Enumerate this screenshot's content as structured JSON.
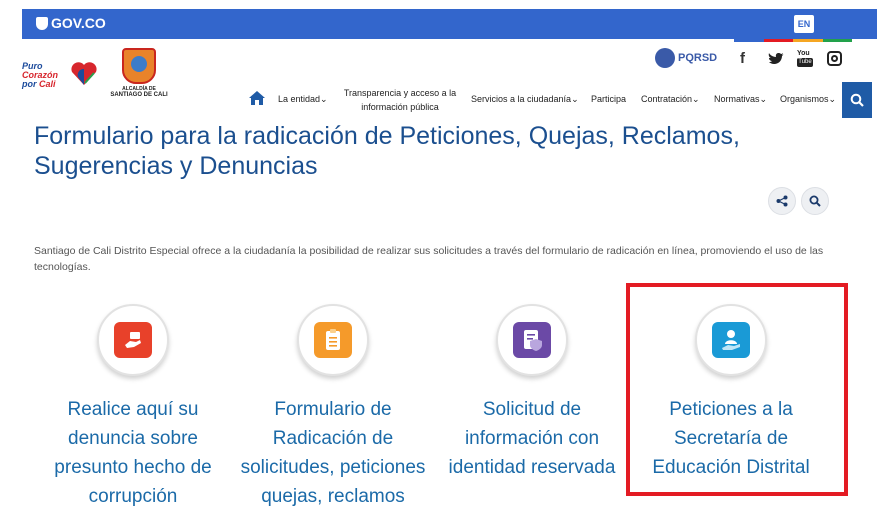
{
  "govbar": {
    "logo_text": "GOV.CO",
    "lang": "EN",
    "strip_colors": [
      "#3366cc",
      "#e31b23",
      "#f5a623",
      "#22a14b"
    ]
  },
  "header": {
    "brand": {
      "line1": "Puro",
      "line2": "Corazón",
      "line3": "por",
      "line4": "Cali"
    },
    "alcaldia": {
      "line1": "ALCALDÍA DE",
      "line2": "SANTIAGO DE CALI"
    },
    "pqrsd": "PQRSD",
    "social": [
      "f",
      "t",
      "yt",
      "ig"
    ]
  },
  "nav": {
    "la_entidad": "La entidad",
    "transparencia": "Transparencia y acceso a la información pública",
    "servicios": "Servicios a la ciudadanía",
    "participa": "Participa",
    "contratacion": "Contratación",
    "normativas": "Normativas",
    "organismos": "Organismos",
    "chevron": "⌄"
  },
  "page": {
    "title": "Formulario para la radicación de Peticiones, Quejas, Reclamos, Sugerencias y Denuncias",
    "intro": "Santiago de Cali Distrito Especial ofrece a la ciudadanía la posibilidad de realizar sus solicitudes a través del formulario de radicación en línea, promoviendo el uso de las tecnologías."
  },
  "cards": [
    {
      "label": "Realice aquí su denuncia sobre presunto hecho de corrupción",
      "color": "#e8412a",
      "icon": "hand-money-icon"
    },
    {
      "label": "Formulario de Radicación de solicitudes, peticiones quejas, reclamos",
      "color": "#f59a2a",
      "icon": "clipboard-icon"
    },
    {
      "label": "Solicitud de información con identidad reservada",
      "color": "#6b49a6",
      "icon": "shield-document-icon"
    },
    {
      "label": "Peticiones a la Secretaría de Educación Distrital",
      "color": "#1a9ad6",
      "icon": "person-hand-icon"
    }
  ],
  "colors": {
    "primary": "#3366cc",
    "title": "#1b4f8f",
    "link": "#1b6aa8",
    "highlight": "#e31b23"
  }
}
